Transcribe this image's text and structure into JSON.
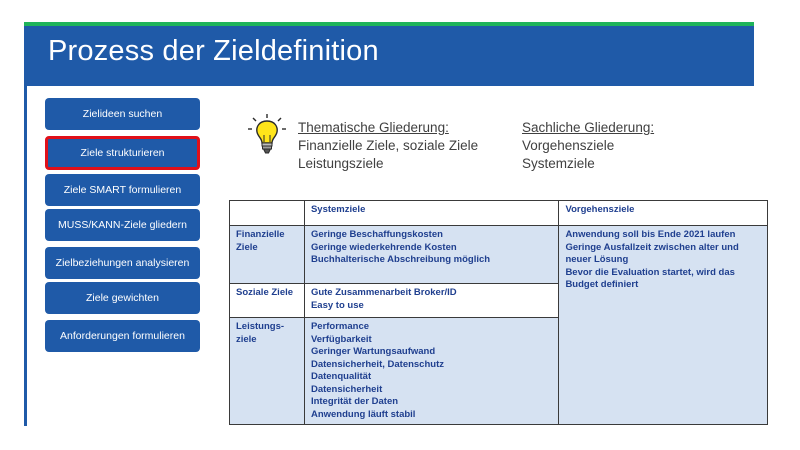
{
  "title": "Prozess der Zieldefinition",
  "nav": [
    {
      "label": "Zielideen suchen",
      "active": false
    },
    {
      "label": "Ziele strukturieren",
      "active": true
    },
    {
      "label": "Ziele SMART formulieren",
      "active": false
    },
    {
      "label": "MUSS/KANN-Ziele gliedern",
      "active": false
    },
    {
      "label": "Zielbeziehungen analysieren",
      "active": false
    },
    {
      "label": "Ziele gewichten",
      "active": false
    },
    {
      "label": "Anforderungen formulieren",
      "active": false
    }
  ],
  "thematic": {
    "heading": "Thematische Gliederung:",
    "line1": "Finanzielle Ziele, soziale Ziele",
    "line2": "Leistungsziele"
  },
  "factual": {
    "heading": "Sachliche Gliederung:",
    "line1": "Vorgehensziele",
    "line2": "Systemziele"
  },
  "table": {
    "headers": [
      "",
      "Systemziele",
      "Vorgehensziele"
    ],
    "rows": [
      {
        "label": [
          "Finanzielle",
          "Ziele"
        ],
        "system": [
          "Geringe Beschaffungskosten",
          "Geringe wiederkehrende Kosten",
          "Buchhalterische Abschreibung möglich"
        ]
      },
      {
        "label": [
          "Soziale Ziele"
        ],
        "system": [
          "Gute Zusammenarbeit Broker/ID",
          "Easy to use"
        ]
      },
      {
        "label": [
          "Leistungs-",
          "ziele"
        ],
        "system": [
          "Performance",
          "Verfügbarkeit",
          "Geringer Wartungsaufwand",
          "Datensicherheit, Datenschutz",
          "Datenqualität",
          "Datensicherheit",
          "Integrität der Daten",
          "Anwendung läuft stabil"
        ]
      }
    ],
    "vorgehen": [
      "Anwendung soll bis Ende 2021 laufen",
      "Geringe Ausfallzeit zwischen alter und",
      "neuer Lösung",
      "Bevor die Evaluation startet, wird das",
      "Budget definiert"
    ]
  },
  "colors": {
    "title_bar": "#1f5aa8",
    "accent_green": "#1fb35a",
    "active_border": "#e0101a",
    "cell_blue": "#d6e2f2"
  },
  "icons": [
    "lightbulb-icon"
  ]
}
